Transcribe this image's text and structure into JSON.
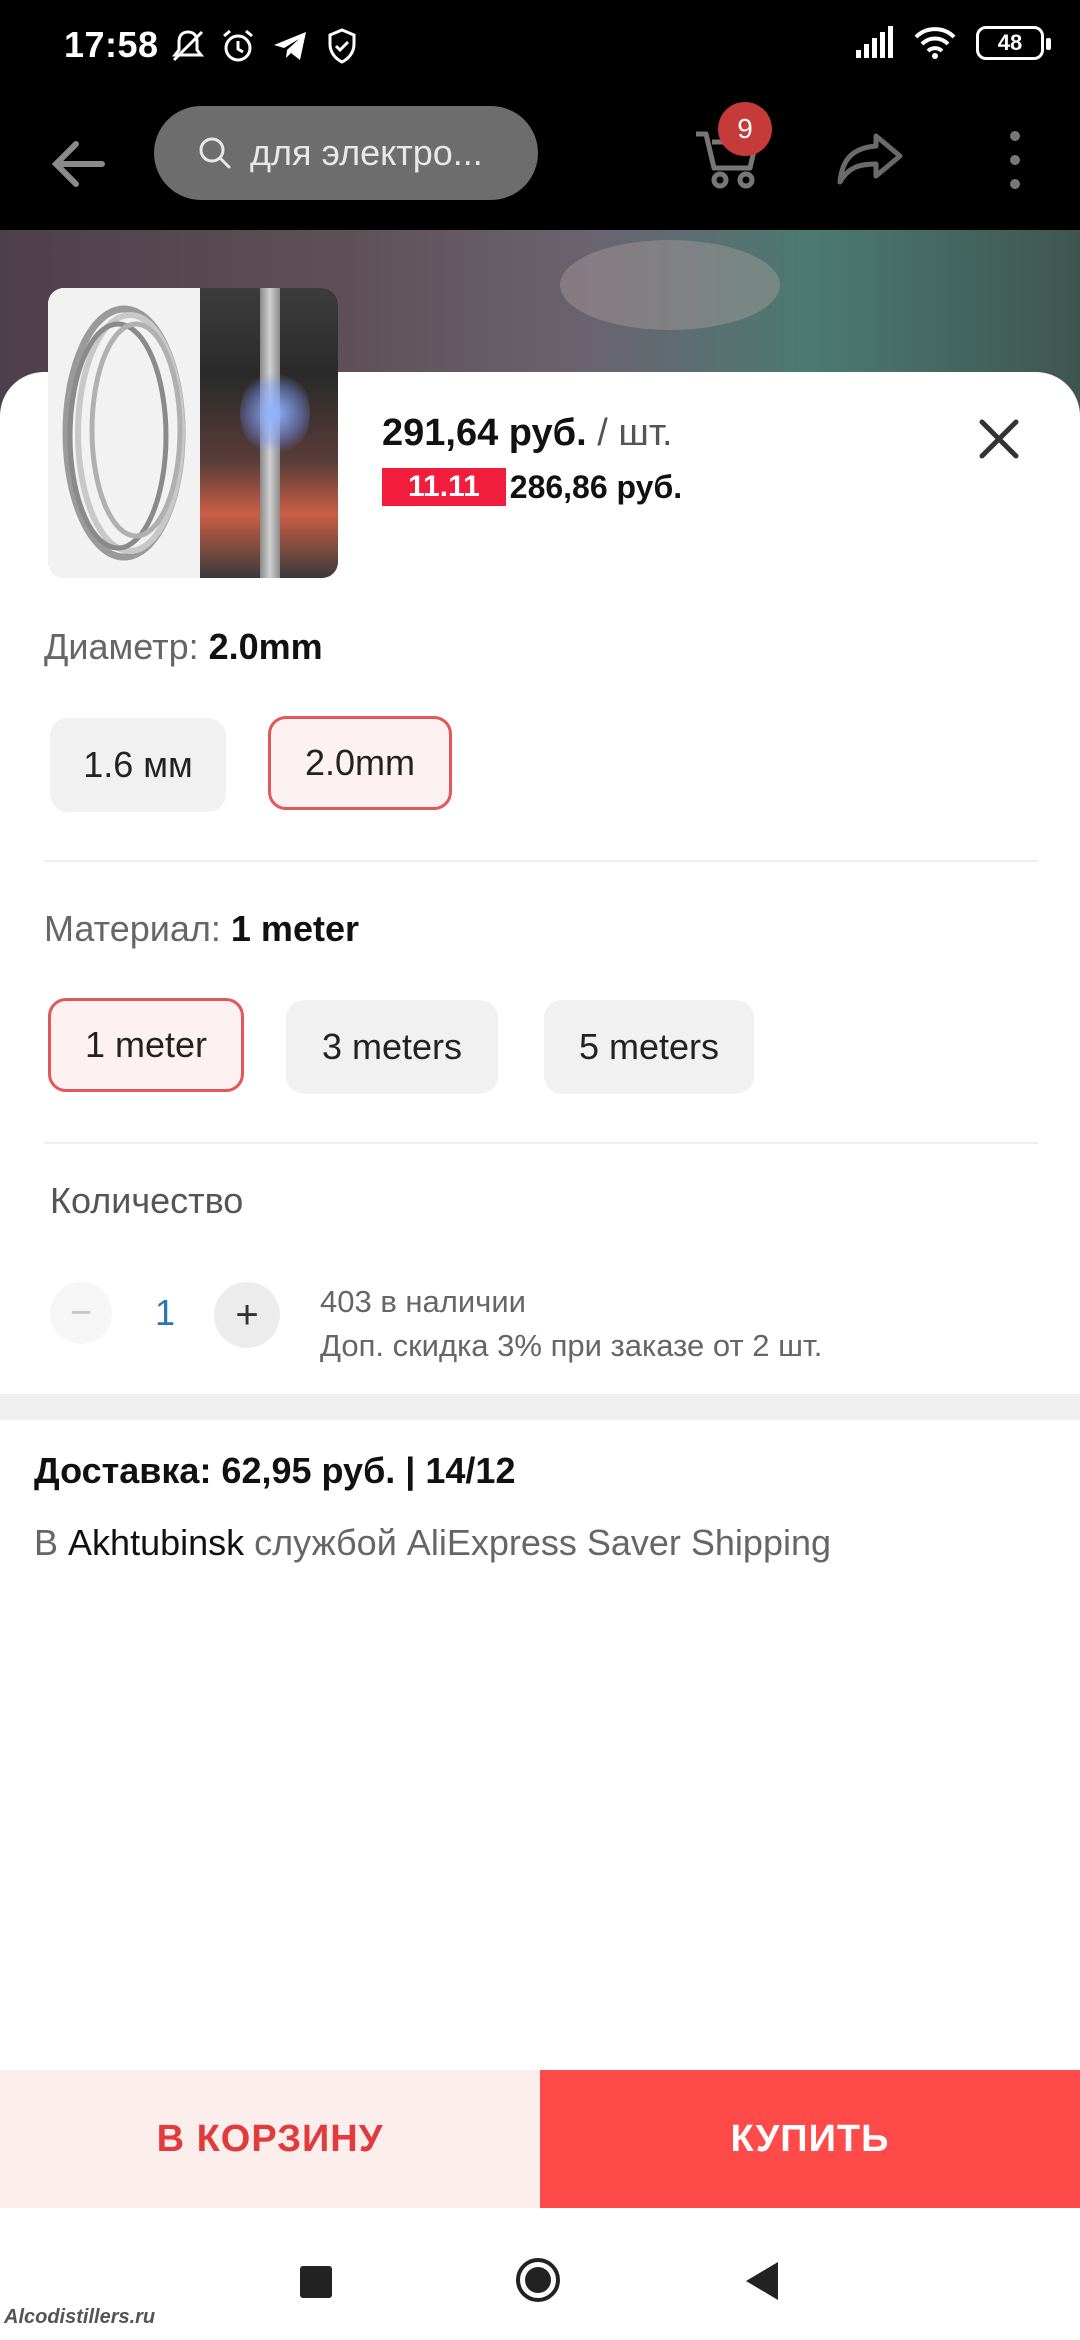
{
  "status_bar": {
    "time": "17:58",
    "battery": "48",
    "icons": [
      "mute-icon",
      "alarm-icon",
      "telegram-icon",
      "shield-icon",
      "signal-icon",
      "wifi-icon",
      "battery-icon"
    ]
  },
  "app_bar": {
    "search_text": "для электро...",
    "cart_count": "9"
  },
  "product": {
    "price": "291,64 руб.",
    "unit": "/ шт.",
    "promo_badge": "11.11",
    "promo_price": "286,86 руб."
  },
  "diameter": {
    "label": "Диаметр:",
    "selected": "2.0mm",
    "options": [
      "1.6 мм",
      "2.0mm"
    ]
  },
  "material": {
    "label": "Материал:",
    "selected": "1 meter",
    "options": [
      "1 meter",
      "3 meters",
      "5 meters"
    ]
  },
  "quantity": {
    "label": "Количество",
    "minus": "−",
    "value": "1",
    "plus": "+",
    "stock": "403 в наличии",
    "discount": "Доп. скидка 3% при заказе от 2 шт."
  },
  "delivery": {
    "title": "Доставка: 62,95 руб. | 14/12",
    "prefix": "В",
    "city": "Akhtubinsk",
    "suffix": "службой AliExpress Saver Shipping"
  },
  "actions": {
    "add_to_cart": "В КОРЗИНУ",
    "buy": "КУПИТЬ"
  },
  "watermark": "Alcodistillers.ru",
  "colors": {
    "accent": "#ff4a4a",
    "accent_text": "#e23b3b",
    "promo": "#f21c3c",
    "selected_border": "#e2575a"
  }
}
